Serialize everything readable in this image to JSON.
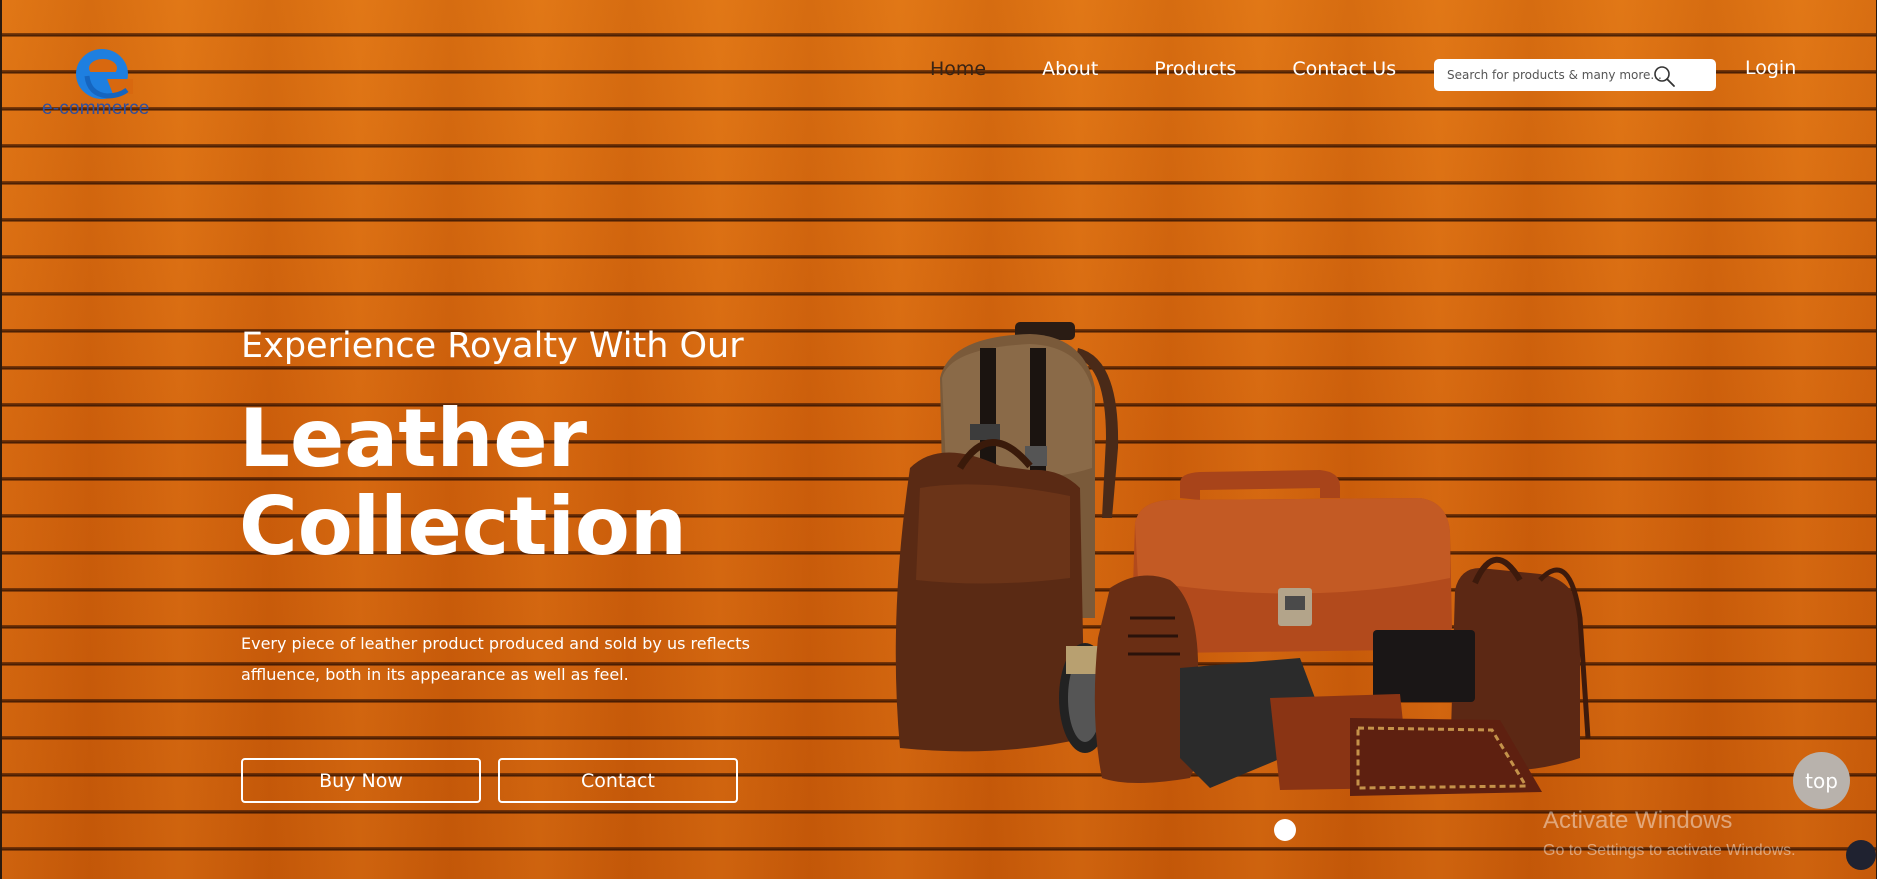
{
  "brand": {
    "name": "e-commerce",
    "logo_colors": [
      "#1e88e5",
      "#1565c0"
    ]
  },
  "nav": {
    "items": [
      {
        "label": "Home",
        "active": true
      },
      {
        "label": "About",
        "active": false
      },
      {
        "label": "Products",
        "active": false
      },
      {
        "label": "Contact Us",
        "active": false
      }
    ],
    "active_color": "#3a2414"
  },
  "search": {
    "placeholder": "Search for products & many more...",
    "value": "",
    "icon": "search-icon"
  },
  "login": {
    "label": "Login"
  },
  "hero": {
    "subtitle": "Experience Royalty With Our",
    "title_line1": "Leather",
    "title_line2": "Collection",
    "description": "Every piece of leather product produced and sold by us reflects affluence, both in its appearance as well as feel.",
    "buy_label": "Buy Now",
    "contact_label": "Contact"
  },
  "carousel": {
    "slides": 1,
    "active_index": 0
  },
  "top_button": {
    "label": "top"
  },
  "watermark": {
    "title": "Activate Windows",
    "subtitle": "Go to Settings to activate Windows."
  },
  "colors": {
    "background": "#d8680f",
    "text": "#ffffff",
    "top_button": "#b8b2ac"
  }
}
